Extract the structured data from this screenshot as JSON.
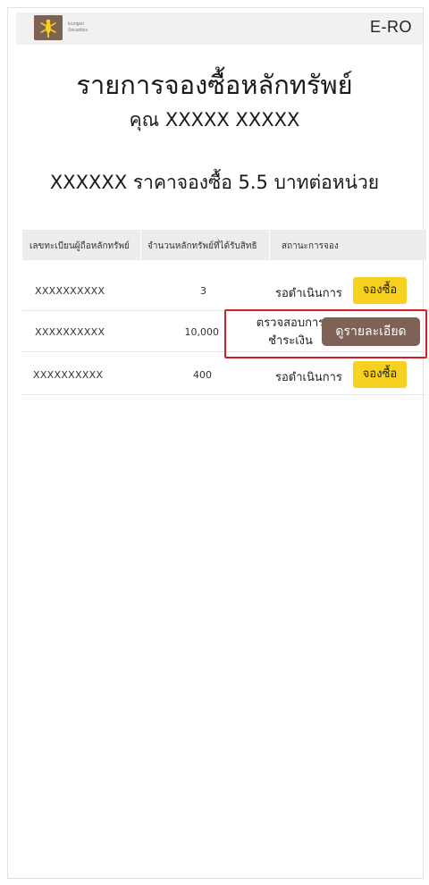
{
  "header": {
    "logo_line1": "krungsri",
    "logo_line2": "Securities",
    "brand_right": "E-RO"
  },
  "page": {
    "title": "รายการจองซื้อหลักทรัพย์",
    "subtitle": "คุณ XXXXX  XXXXX",
    "price_line": "XXXXXX  ราคาจองซื้อ 5.5 บาทต่อหน่วย"
  },
  "table": {
    "columns": [
      "เลขทะเบียนผู้ถือหลักทรัพย์",
      "จำนวนหลักทรัพย์ที่ได้รับสิทธิ",
      "สถานะการจอง"
    ],
    "rows": [
      {
        "id": "XXXXXXXXXX",
        "qty": "3",
        "status": "รอดำเนินการ",
        "action": "จองซื้อ"
      },
      {
        "id": "XXXXXXXXXX",
        "qty": "10,000",
        "status_line1": "ตรวจสอบการ",
        "status_line2": "ชำระเงิน",
        "action": "ดูรายละเอียด"
      },
      {
        "id": "XXXXXXXXXX",
        "qty": "400",
        "status": "รอดำเนินการ",
        "action": "จองซื้อ"
      }
    ]
  },
  "colors": {
    "yellow_button": "#f7d11f",
    "brown_button": "#7d6255",
    "highlight": "#d0202a"
  }
}
